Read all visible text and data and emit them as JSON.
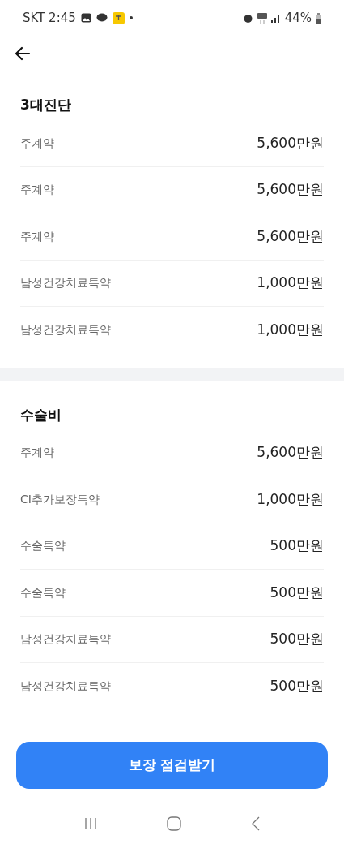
{
  "status_bar": {
    "carrier_time": "SKT 2:45",
    "battery": "44%"
  },
  "sections": [
    {
      "title": "3대진단",
      "rows": [
        {
          "label": "주계약",
          "amount": "5,600만원"
        },
        {
          "label": "주계약",
          "amount": "5,600만원"
        },
        {
          "label": "주계약",
          "amount": "5,600만원"
        },
        {
          "label": "남성건강치료특약",
          "amount": "1,000만원"
        },
        {
          "label": "남성건강치료특약",
          "amount": "1,000만원"
        }
      ]
    },
    {
      "title": "수술비",
      "rows": [
        {
          "label": "주계약",
          "amount": "5,600만원"
        },
        {
          "label": "CI추가보장특약",
          "amount": "1,000만원"
        },
        {
          "label": "수술특약",
          "amount": "500만원"
        },
        {
          "label": "수술특약",
          "amount": "500만원"
        },
        {
          "label": "남성건강치료특약",
          "amount": "500만원"
        },
        {
          "label": "남성건강치료특약",
          "amount": "500만원"
        }
      ]
    }
  ],
  "cta_button": "보장 점검받기"
}
